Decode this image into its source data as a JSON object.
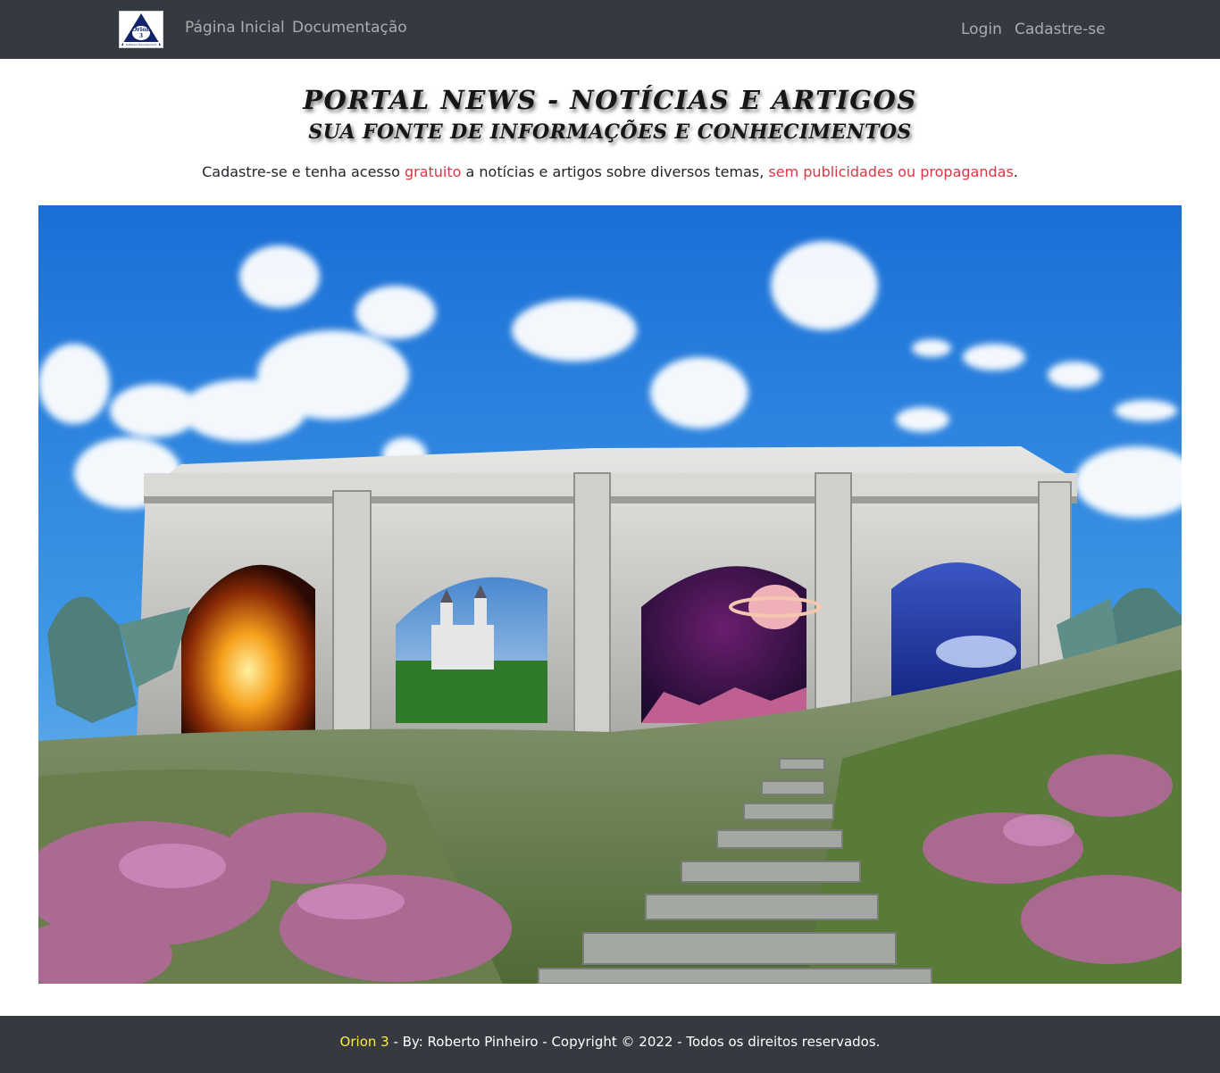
{
  "navbar": {
    "logo": {
      "text": "Orion",
      "subtext": "3",
      "tagline": "Software Development"
    },
    "links": [
      {
        "label": "Página Inicial"
      },
      {
        "label": "Documentação"
      }
    ],
    "auth": {
      "login": "Login",
      "signup": "Cadastre-se"
    }
  },
  "header": {
    "title": "PORTAL NEWS - NOTÍCIAS E ARTIGOS",
    "subtitle": "SUA FONTE DE INFORMAÇÕES E CONHECIMENTOS",
    "lead": {
      "part1": "Cadastre-se e tenha acesso ",
      "highlight1": "gratuito",
      "part2": " a notícias e artigos sobre diversos temas, ",
      "highlight2": "sem publicidades ou propagandas",
      "part3": "."
    }
  },
  "footer": {
    "brand": "Orion 3",
    "text": " - By: Roberto Pinheiro - Copyright © 2022 - Todos os direitos reservados."
  },
  "colors": {
    "navbar_bg": "#343a40",
    "nav_link": "rgba(255,255,255,0.58)",
    "accent": "#dc3545",
    "footer_brand": "#ffeb3b"
  }
}
